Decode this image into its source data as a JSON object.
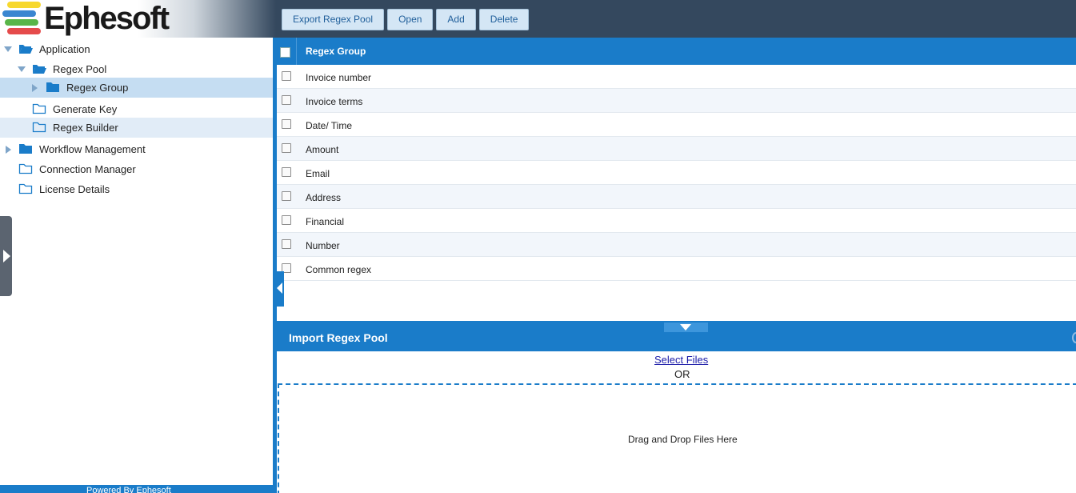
{
  "brand": {
    "name": "Ephesoft",
    "bar_colors": [
      "#f7d82e",
      "#3a86d0",
      "#59b548",
      "#e54b4b"
    ]
  },
  "toolbar": {
    "export_label": "Export Regex Pool",
    "open_label": "Open",
    "add_label": "Add",
    "delete_label": "Delete"
  },
  "tree": {
    "items": [
      {
        "label": "Application",
        "state": "expanded",
        "level": 0
      },
      {
        "label": "Regex Pool",
        "state": "expanded",
        "level": 1
      },
      {
        "label": "Regex Group",
        "state": "collapsed",
        "level": 2,
        "selected": true
      },
      {
        "label": "Generate Key",
        "state": "leaf",
        "level": 1
      },
      {
        "label": "Regex Builder",
        "state": "leaf",
        "level": 1
      },
      {
        "label": "Workflow Management",
        "state": "collapsed",
        "level": 0
      },
      {
        "label": "Connection Manager",
        "state": "leaf",
        "level": 0
      },
      {
        "label": "License Details",
        "state": "leaf",
        "level": 0
      }
    ]
  },
  "footer": {
    "text": "Powered By Ephesoft"
  },
  "grid": {
    "column_header": "Regex Group",
    "rows": [
      "Invoice number",
      "Invoice terms",
      "Date/ Time",
      "Amount",
      "Email",
      "Address",
      "Financial",
      "Number",
      "Common regex"
    ]
  },
  "import": {
    "title": "Import Regex Pool",
    "select_files": "Select Files",
    "or": "OR",
    "drop_text": "Drag and Drop Files Here"
  },
  "colors": {
    "accent": "#1a7cc9",
    "header_bg": "#34485e",
    "selected_row": "#c5ddf2"
  }
}
